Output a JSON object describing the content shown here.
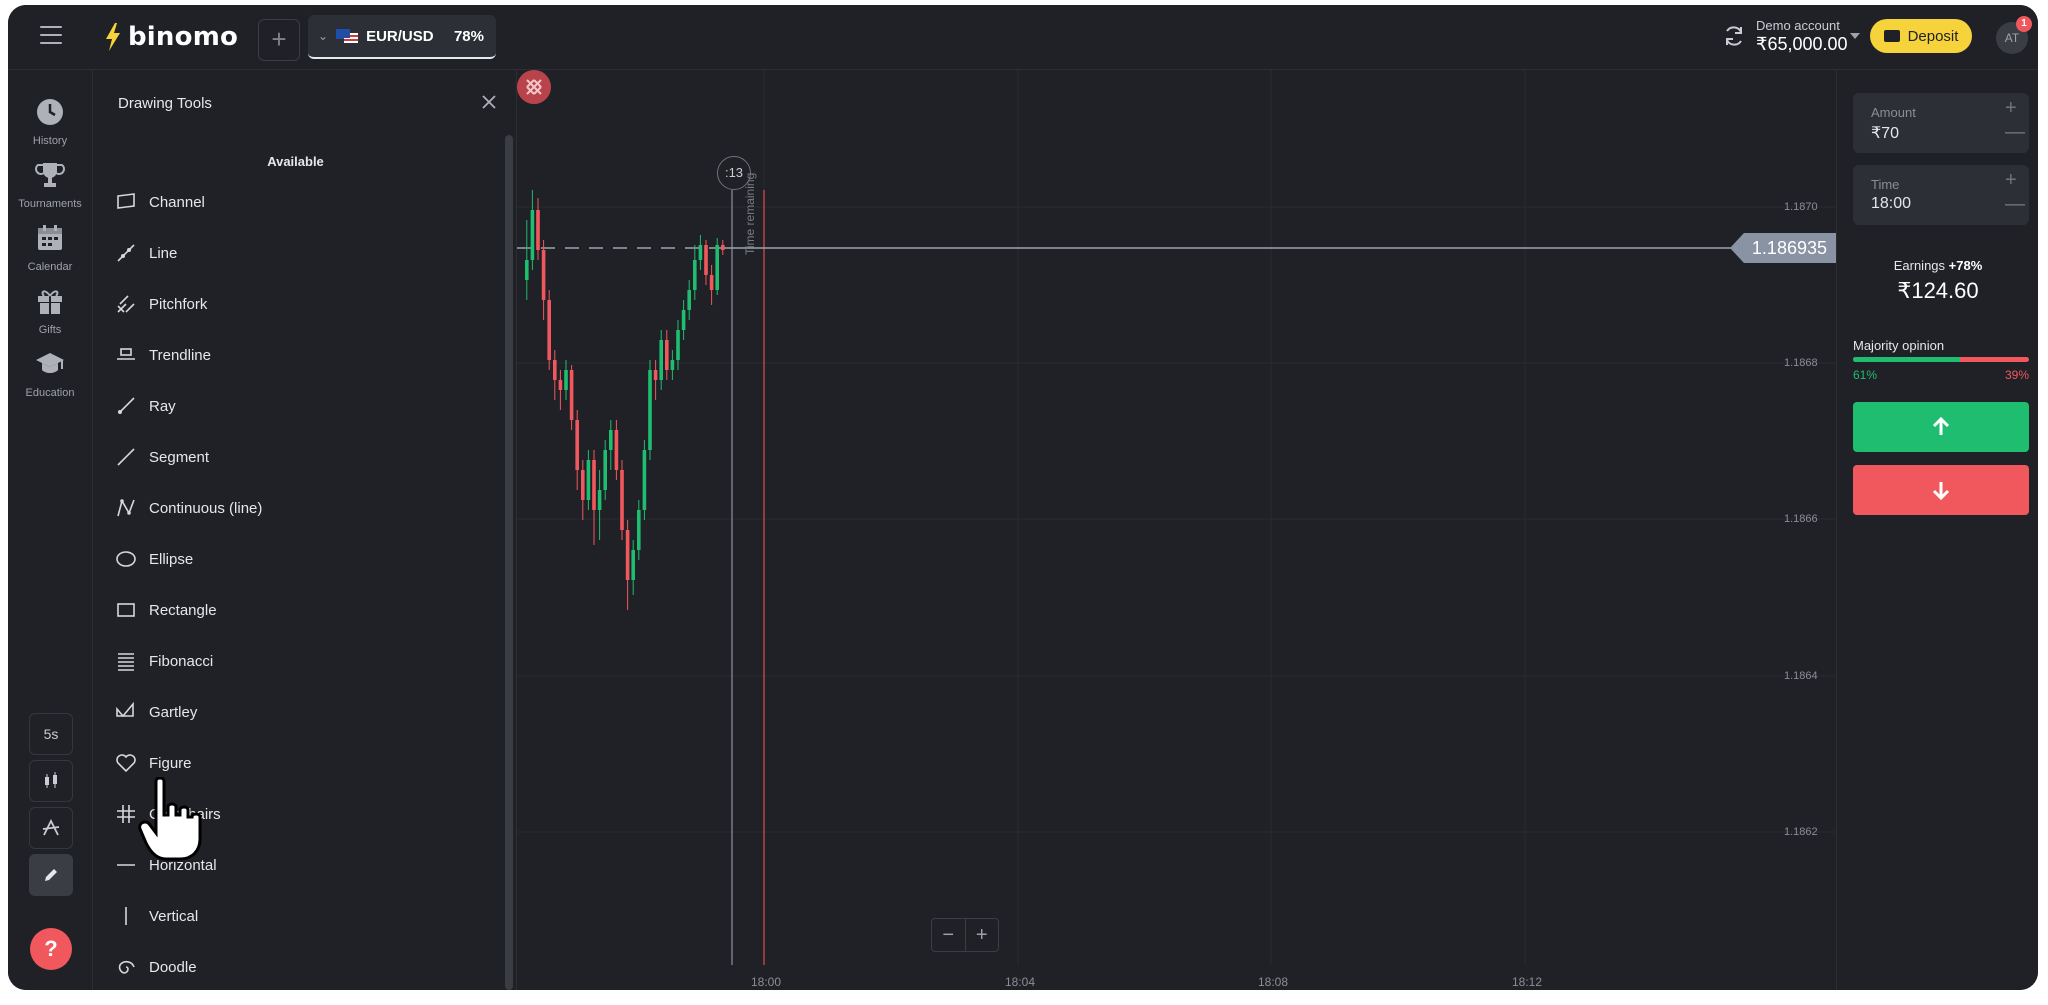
{
  "header": {
    "logo_text": "binomo",
    "asset_name": "EUR/USD",
    "asset_payout": "78%",
    "account_label": "Demo account",
    "account_balance": "₹65,000.00",
    "deposit_label": "Deposit",
    "avatar_initials": "AT",
    "notification_count": "1",
    "brand_color": "#f6d33b"
  },
  "leftnav": {
    "items": [
      {
        "label": "History",
        "icon": "history-icon"
      },
      {
        "label": "Tournaments",
        "icon": "trophy-icon"
      },
      {
        "label": "Calendar",
        "icon": "calendar-icon"
      },
      {
        "label": "Gifts",
        "icon": "gift-icon"
      },
      {
        "label": "Education",
        "icon": "graduation-cap-icon"
      }
    ],
    "timeframe_label": "5s",
    "help_label": "?"
  },
  "drawing_panel": {
    "title": "Drawing Tools",
    "section_label": "Available",
    "tools": [
      {
        "label": "Channel",
        "icon": "channel-icon"
      },
      {
        "label": "Line",
        "icon": "line-icon"
      },
      {
        "label": "Pitchfork",
        "icon": "pitchfork-icon"
      },
      {
        "label": "Trendline",
        "icon": "trendline-icon"
      },
      {
        "label": "Ray",
        "icon": "ray-icon"
      },
      {
        "label": "Segment",
        "icon": "segment-icon"
      },
      {
        "label": "Continuous (line)",
        "icon": "continuous-line-icon"
      },
      {
        "label": "Ellipse",
        "icon": "ellipse-icon"
      },
      {
        "label": "Rectangle",
        "icon": "rectangle-icon"
      },
      {
        "label": "Fibonacci",
        "icon": "fibonacci-icon"
      },
      {
        "label": "Gartley",
        "icon": "gartley-icon"
      },
      {
        "label": "Figure",
        "icon": "heart-icon"
      },
      {
        "label": "Crosshairs",
        "icon": "hash-icon"
      },
      {
        "label": "Horizontal",
        "icon": "horizontal-line-icon"
      },
      {
        "label": "Vertical",
        "icon": "vertical-line-icon"
      },
      {
        "label": "Doodle",
        "icon": "spiral-icon"
      }
    ]
  },
  "chart": {
    "current_price": "1.186935",
    "timer_label": ":13",
    "time_remaining_label": "Time remaining",
    "y_ticks": [
      "1.1870",
      "1.1868",
      "1.1866",
      "1.1864",
      "1.1862"
    ],
    "x_ticks": [
      "18:00",
      "18:04",
      "18:08",
      "18:12"
    ],
    "up_color": "#1fbd6f",
    "down_color": "#f0585e"
  },
  "trade": {
    "amount_label": "Amount",
    "amount_value": "₹70",
    "time_label": "Time",
    "time_value": "18:00",
    "earnings_label": "Earnings",
    "earnings_pct": "+78%",
    "earnings_value": "₹124.60",
    "majority_label": "Majority opinion",
    "majority_up": "61%",
    "majority_down": "39%",
    "majority_up_fraction": 0.61
  }
}
